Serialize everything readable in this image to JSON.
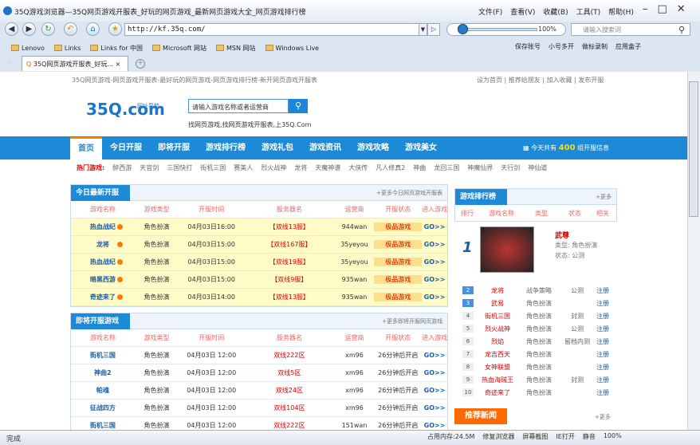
{
  "window": {
    "title": "35Q游戏浏览器—35Q网页游戏开服表_好玩的网页游戏_最新网页游戏大全_网页游戏排行榜",
    "menu": [
      "文件(F)",
      "查看(V)",
      "收藏(B)",
      "工具(T)",
      "帮助(H)"
    ]
  },
  "address": {
    "url": "http://kf.35q.com/",
    "zoom": "100%",
    "search_placeholder": "请输入搜索词"
  },
  "favorites": [
    "Lenovo",
    "Links",
    "Links for 中国",
    "Microsoft 网站",
    "MSN 网站",
    "Windows Live"
  ],
  "tools": [
    "保存账号",
    "小号多开",
    "做标录制",
    "应用盒子"
  ],
  "tab": {
    "label": "35Q网页游戏开服表_好玩..."
  },
  "top_links": {
    "breadcrumb": "35Q网页游戏-网页游戏开服表-最好玩的网页游戏-网页游戏排行榜-新开网页游戏开服表",
    "right": "设为首页 | 推荐给朋友 | 加入收藏 | 发布开服"
  },
  "logo": {
    "text": "35Q.com",
    "sub": "网址导航",
    "search_placeholder": "请输入游戏名称或者运营商",
    "slogan": "找网页游戏,找网页游戏开服表,上35Q.Com"
  },
  "nav": [
    "首页",
    "今日开服",
    "即将开服",
    "游戏排行榜",
    "游戏礼包",
    "游戏资讯",
    "游戏攻略",
    "游戏美女"
  ],
  "opens": {
    "pre": "今天共有",
    "count": "400",
    "post": "组开服信息"
  },
  "hot": {
    "label": "热门游戏:",
    "items": [
      "醉西游",
      "天官剑",
      "三国快打",
      "街机三国",
      "赛美人",
      "烈火战神",
      "龙将",
      "天魔神谱",
      "大侠传",
      "凡人修真2",
      "神曲",
      "龙回三国",
      "神魔仙界",
      "天行剑",
      "神仙道"
    ]
  },
  "today": {
    "title": "今日最新开服",
    "more": "+更多今日网页游戏开服表",
    "headers": [
      "游戏名称",
      "游戏类型",
      "开服时间",
      "服务器名",
      "运营商",
      "开服状态",
      "进入游戏"
    ],
    "rows": [
      [
        "热血战纪",
        "角色扮演",
        "04月03日16:00",
        "【双线13服】",
        "944wan",
        "极品游戏",
        "GO>>"
      ],
      [
        "龙将",
        "角色扮演",
        "04月03日15:00",
        "【双线167服】",
        "35yeyou",
        "极品游戏",
        "GO>>"
      ],
      [
        "热血战纪",
        "角色扮演",
        "04月03日15:00",
        "【双线19服】",
        "35yeyou",
        "极品游戏",
        "GO>>"
      ],
      [
        "暗黑西游",
        "角色扮演",
        "04月03日15:00",
        "【双线9服】",
        "935wan",
        "极品游戏",
        "GO>>"
      ],
      [
        "奇迹来了",
        "角色扮演",
        "04月03日14:00",
        "【双线13服】",
        "935wan",
        "极品游戏",
        "GO>>"
      ]
    ]
  },
  "upcoming": {
    "title": "即将开服游戏",
    "more": "+更多即将开服网页游戏",
    "headers": [
      "游戏名称",
      "游戏类型",
      "开服时间",
      "服务器名",
      "运营商",
      "开服状态",
      "进入游戏"
    ],
    "rows": [
      [
        "街机三国",
        "角色扮演",
        "04月03日 12:00",
        "双线222区",
        "xm96",
        "26分钟后开启",
        "GO>>"
      ],
      [
        "神曲2",
        "角色扮演",
        "04月03日 12:00",
        "双线5区",
        "xm96",
        "26分钟后开启",
        "GO>>"
      ],
      [
        "帕魂",
        "角色扮演",
        "04月03日 12:00",
        "双线24区",
        "xm96",
        "26分钟后开启",
        "GO>>"
      ],
      [
        "征战四方",
        "角色扮演",
        "04月03日 12:00",
        "双线104区",
        "xm96",
        "26分钟后开启",
        "GO>>"
      ],
      [
        "街机三国",
        "角色扮演",
        "04月03日 12:00",
        "双线222区",
        "151wan",
        "26分钟后开启",
        "GO>>"
      ]
    ]
  },
  "rank": {
    "title": "游戏排行榜",
    "more": "+更多",
    "headers": [
      "排行",
      "游戏名称",
      "类型",
      "状态",
      "相关"
    ],
    "featured": {
      "num": "1",
      "name": "武尊",
      "type": "类型: 角色扮演",
      "state": "状态: 公测"
    },
    "rows": [
      [
        "2",
        "龙将",
        "战争策略",
        "公测",
        "注册"
      ],
      [
        "3",
        "武易",
        "角色扮演",
        "",
        "注册"
      ],
      [
        "4",
        "街机三国",
        "角色扮演",
        "封测",
        "注册"
      ],
      [
        "5",
        "烈火战神",
        "角色扮演",
        "公测",
        "注册"
      ],
      [
        "6",
        "烈焰",
        "角色扮演",
        "留档内测",
        "注册"
      ],
      [
        "7",
        "龙吉西天",
        "角色扮演",
        "",
        "注册"
      ],
      [
        "8",
        "女神联盟",
        "角色扮演",
        "",
        "注册"
      ],
      [
        "9",
        "热血海贼王",
        "角色扮演",
        "封测",
        "注册"
      ],
      [
        "10",
        "奇迹来了",
        "角色扮演",
        "",
        "注册"
      ]
    ]
  },
  "news": {
    "title": "推荐新闻",
    "more": "+更多"
  },
  "status": {
    "text": "完成",
    "items": [
      "占用内存:24.5M",
      "修复浏览器",
      "屏幕截图",
      "IE打开",
      "静音",
      "100%"
    ]
  }
}
